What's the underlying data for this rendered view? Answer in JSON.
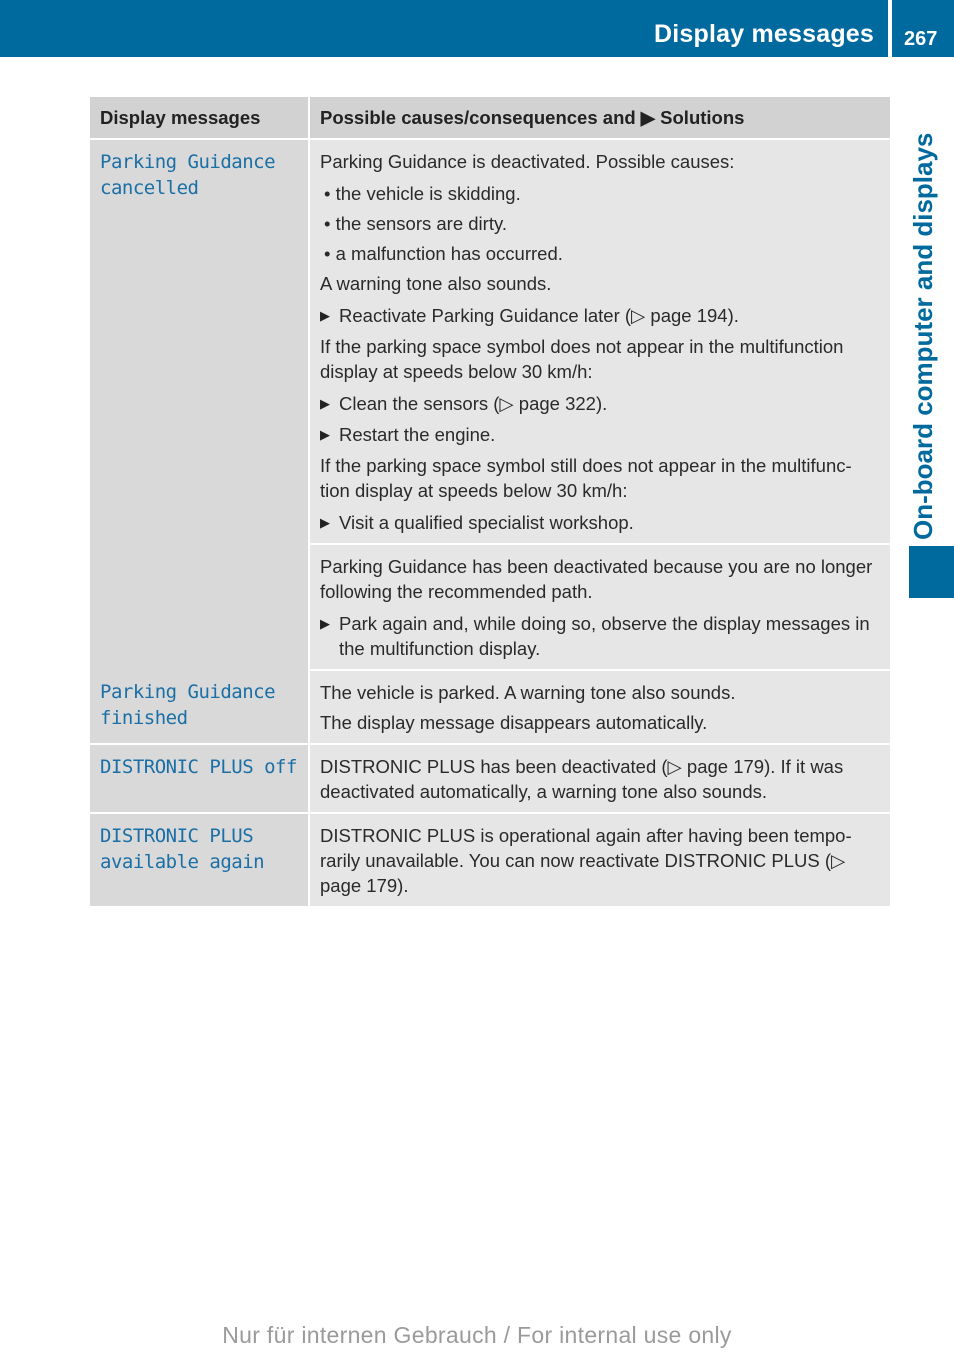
{
  "header": {
    "section_title": "Display messages",
    "page_number": "267"
  },
  "side_tab": {
    "label": "On-board computer and displays"
  },
  "table": {
    "columns": [
      "Display messages",
      "Possible causes/consequences and ▶ Solutions"
    ],
    "rows": [
      {
        "message": "Parking Guidance cancelled",
        "blocks": [
          {
            "intro": "Parking Guidance is deactivated. Possible causes:",
            "bullets": [
              "• the vehicle is skidding.",
              "• the sensors are dirty.",
              "• a malfunction has occurred."
            ],
            "note": "A warning tone also sounds.",
            "action1": "Reactivate Parking Guidance later (▷ page 194).",
            "cond1": "If the parking space symbol does not appear in the multifunction display at speeds below 30 km/h:",
            "action2": "Clean the sensors (▷ page 322).",
            "action3": "Restart the engine.",
            "cond2": "If the parking space symbol still does not appear in the multifunc-tion display at speeds below 30 km/h:",
            "action4": "Visit a qualified specialist workshop."
          },
          {
            "intro": "Parking Guidance has been deactivated because you are no longer following the recommended path.",
            "action1": "Park again and, while doing so, observe the display messages in the multifunction display."
          }
        ]
      },
      {
        "message": "Parking Guidance finished",
        "line1": "The vehicle is parked. A warning tone also sounds.",
        "line2": "The display message disappears automatically."
      },
      {
        "message": "DISTRONIC PLUS off",
        "line1": "DISTRONIC PLUS has been deactivated (▷ page 179). If it was deactivated automatically, a warning tone also sounds."
      },
      {
        "message": "DISTRONIC PLUS available again",
        "line1": "DISTRONIC PLUS is operational again after having been tempo-rarily unavailable. You can now reactivate DISTRONIC PLUS (▷ page 179)."
      }
    ]
  },
  "icons": {
    "action_marker": "▶"
  },
  "footer": {
    "watermark": "Nur für internen Gebrauch / For internal use only"
  }
}
